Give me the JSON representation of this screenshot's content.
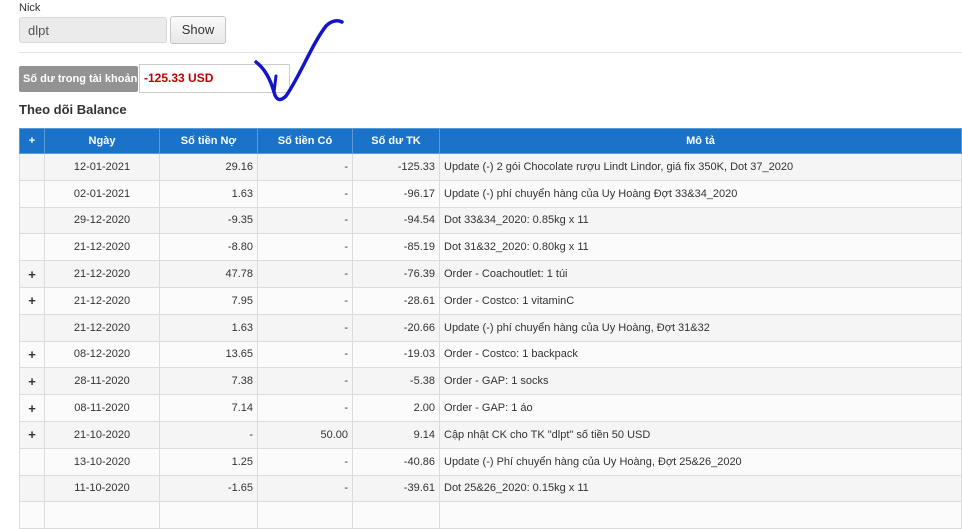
{
  "nick": {
    "label": "Nick",
    "value": "dlpt"
  },
  "show_button": "Show",
  "balance": {
    "label": "Số dư trong tài khoản:",
    "value": "-125.33 USD"
  },
  "section_title": "Theo dõi Balance",
  "table": {
    "columns": [
      "+",
      "Ngày",
      "Số tiền Nợ",
      "Số tiền Có",
      "Số dư TK",
      "Mô tả"
    ],
    "rows": [
      {
        "expand": "",
        "date": "12-01-2021",
        "debit": "29.16",
        "credit": "-",
        "balance": "-125.33",
        "desc": "Update (-) 2 gói Chocolate rượu Lindt Lindor, giá fix 350K, Dot 37_2020"
      },
      {
        "expand": "",
        "date": "02-01-2021",
        "debit": "1.63",
        "credit": "-",
        "balance": "-96.17",
        "desc": "Update (-) phí chuyển hàng của Uy Hoàng Đợt 33&34_2020"
      },
      {
        "expand": "",
        "date": "29-12-2020",
        "debit": "-9.35",
        "credit": "-",
        "balance": "-94.54",
        "desc": "Dot 33&34_2020: 0.85kg x 11"
      },
      {
        "expand": "",
        "date": "21-12-2020",
        "debit": "-8.80",
        "credit": "-",
        "balance": "-85.19",
        "desc": "Dot 31&32_2020: 0.80kg x 11"
      },
      {
        "expand": "+",
        "date": "21-12-2020",
        "debit": "47.78",
        "credit": "-",
        "balance": "-76.39",
        "desc": "Order - Coachoutlet: 1 túi"
      },
      {
        "expand": "+",
        "date": "21-12-2020",
        "debit": "7.95",
        "credit": "-",
        "balance": "-28.61",
        "desc": "Order - Costco: 1 vitaminC"
      },
      {
        "expand": "",
        "date": "21-12-2020",
        "debit": "1.63",
        "credit": "-",
        "balance": "-20.66",
        "desc": "Update (-) phí chuyển hàng của Uy Hoàng, Đợt 31&32"
      },
      {
        "expand": "+",
        "date": "08-12-2020",
        "debit": "13.65",
        "credit": "-",
        "balance": "-19.03",
        "desc": "Order - Costco: 1 backpack"
      },
      {
        "expand": "+",
        "date": "28-11-2020",
        "debit": "7.38",
        "credit": "-",
        "balance": "-5.38",
        "desc": "Order - GAP: 1 socks"
      },
      {
        "expand": "+",
        "date": "08-11-2020",
        "debit": "7.14",
        "credit": "-",
        "balance": "2.00",
        "desc": "Order - GAP: 1 áo"
      },
      {
        "expand": "+",
        "date": "21-10-2020",
        "debit": "-",
        "credit": "50.00",
        "balance": "9.14",
        "desc": "Cập nhật CK cho TK \"dlpt\" số tiền 50 USD"
      },
      {
        "expand": "",
        "date": "13-10-2020",
        "debit": "1.25",
        "credit": "-",
        "balance": "-40.86",
        "desc": "Update (-) Phí chuyển hàng của Uy Hoàng, Đợt 25&26_2020"
      },
      {
        "expand": "",
        "date": "11-10-2020",
        "debit": "-1.65",
        "credit": "-",
        "balance": "-39.61",
        "desc": "Dot 25&26_2020: 0.15kg x 11"
      },
      {
        "expand": "",
        "date": "",
        "debit": "",
        "credit": "",
        "balance": "",
        "desc": ""
      }
    ]
  }
}
